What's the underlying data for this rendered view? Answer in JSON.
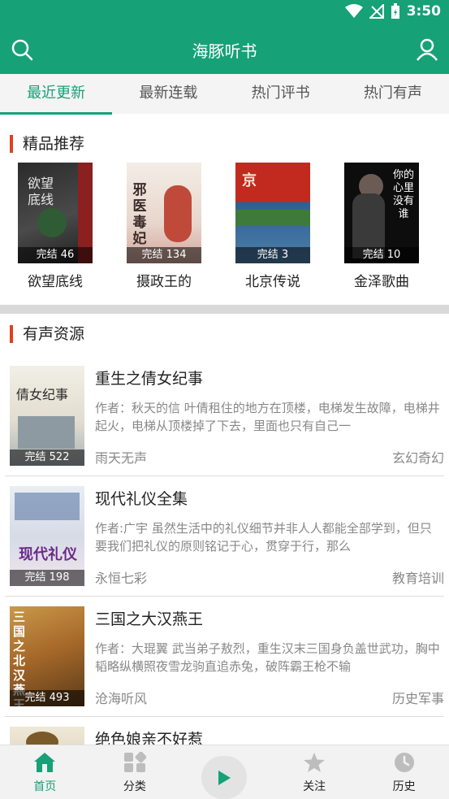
{
  "status_bar": {
    "time": "3:50"
  },
  "app_bar": {
    "title": "海豚听书",
    "search_icon": "search-icon",
    "user_icon": "user-icon"
  },
  "tabs": [
    {
      "label": "最近更新",
      "active": true
    },
    {
      "label": "最新连载"
    },
    {
      "label": "热门评书"
    },
    {
      "label": "热门有声"
    }
  ],
  "recommended": {
    "header": "精品推荐",
    "items": [
      {
        "name": "欲望底线",
        "badge": "完结 46",
        "cover_text": "欲望底线"
      },
      {
        "name": "摄政王的",
        "badge": "完结 134",
        "cover_text": "邪医毒妃"
      },
      {
        "name": "北京传说",
        "badge": "完结 3",
        "cover_text": "京"
      },
      {
        "name": "金泽歌曲",
        "badge": "完结 10",
        "cover_text": "你的心里没有谁"
      }
    ]
  },
  "audio": {
    "header": "有声资源",
    "items": [
      {
        "title": "重生之倩女纪事",
        "desc": "作者：秋天的信 叶倩租住的地方在顶楼，电梯发生故障，电梯井起火，电梯从顶楼掉了下去，里面也只有自己一",
        "author": "雨天无声",
        "category": "玄幻奇幻",
        "badge": "完结 522",
        "cover_text": "倩女纪事"
      },
      {
        "title": "现代礼仪全集",
        "desc": "作者:广宇 虽然生活中的礼仪细节并非人人都能全部学到，但只要我们把礼仪的原则铭记于心，贯穿于行，那么",
        "author": "永恒七彩",
        "category": "教育培训",
        "badge": "完结 198",
        "cover_text": "现代礼仪"
      },
      {
        "title": "三国之大汉燕王",
        "desc": "作者：大琨翼 武当弟子敖烈，重生汉末三国身负盖世武功，胸中韬略纵横照夜雪龙驹直追赤兔，破阵霸王枪不输",
        "author": "沧海听风",
        "category": "历史军事",
        "badge": "完结 493",
        "cover_text": "三国之北汉燕王"
      },
      {
        "title": "绝色娘亲不好惹",
        "desc": "",
        "author": "",
        "category": "",
        "badge": "",
        "cover_text": ""
      }
    ]
  },
  "bottom_nav": [
    {
      "label": "首页",
      "icon": "home-icon",
      "active": true
    },
    {
      "label": "分类",
      "icon": "category-icon"
    },
    {
      "label": "",
      "icon": "play-icon"
    },
    {
      "label": "关注",
      "icon": "star-icon"
    },
    {
      "label": "历史",
      "icon": "history-icon"
    }
  ],
  "colors": {
    "primary": "#16a176",
    "accent_bar": "#e2401f"
  }
}
